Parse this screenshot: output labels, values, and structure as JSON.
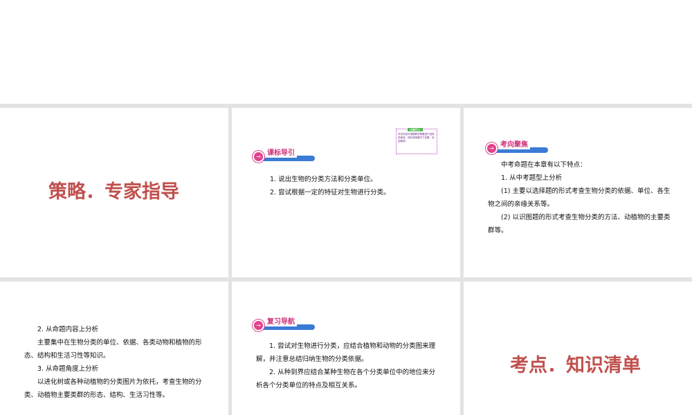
{
  "slides": {
    "s1": {
      "title": "策略．专家指导"
    },
    "s2": {
      "badge": "课标导引",
      "tip_title": "温馨提示",
      "tip_body": "本页内容可根据教学需要进行选择性使用，请在放映模式下查看，欢迎使用！",
      "lines": [
        "1. 说出生物的分类方法和分类单位。",
        "2. 尝试根据一定的特征对生物进行分类。"
      ]
    },
    "s3": {
      "badge": "考向聚焦",
      "lines": [
        "中考命题在本章有以下特点：",
        "1. 从中考题型上分析",
        "(1) 主要以选择题的形式考查生物分类的依据、单位、各生物之间的亲缘关系等。",
        "(2) 以识图题的形式考查生物分类的方法、动植物的主要类群等。"
      ]
    },
    "s4": {
      "lines": [
        "2. 从命题内容上分析",
        "主要集中在生物分类的单位、依据、各类动物和植物的形态、结构和生活习性等知识。",
        "3. 从命题角度上分析",
        "以进化树或各种动植物的分类图片为依托，考查生物的分类、动植物主要类群的形态、结构、生活习性等。"
      ]
    },
    "s5": {
      "badge": "复习导航",
      "lines": [
        "1. 尝试对生物进行分类，应结合植物和动物的分类图来理解，并注意总结归纳生物的分类依据。",
        "2. 从种到界应结合某种生物在各个分类单位中的地位来分析各个分类单位的特点及相互关系。"
      ]
    },
    "s6": {
      "title": "考点．知识清单"
    }
  }
}
